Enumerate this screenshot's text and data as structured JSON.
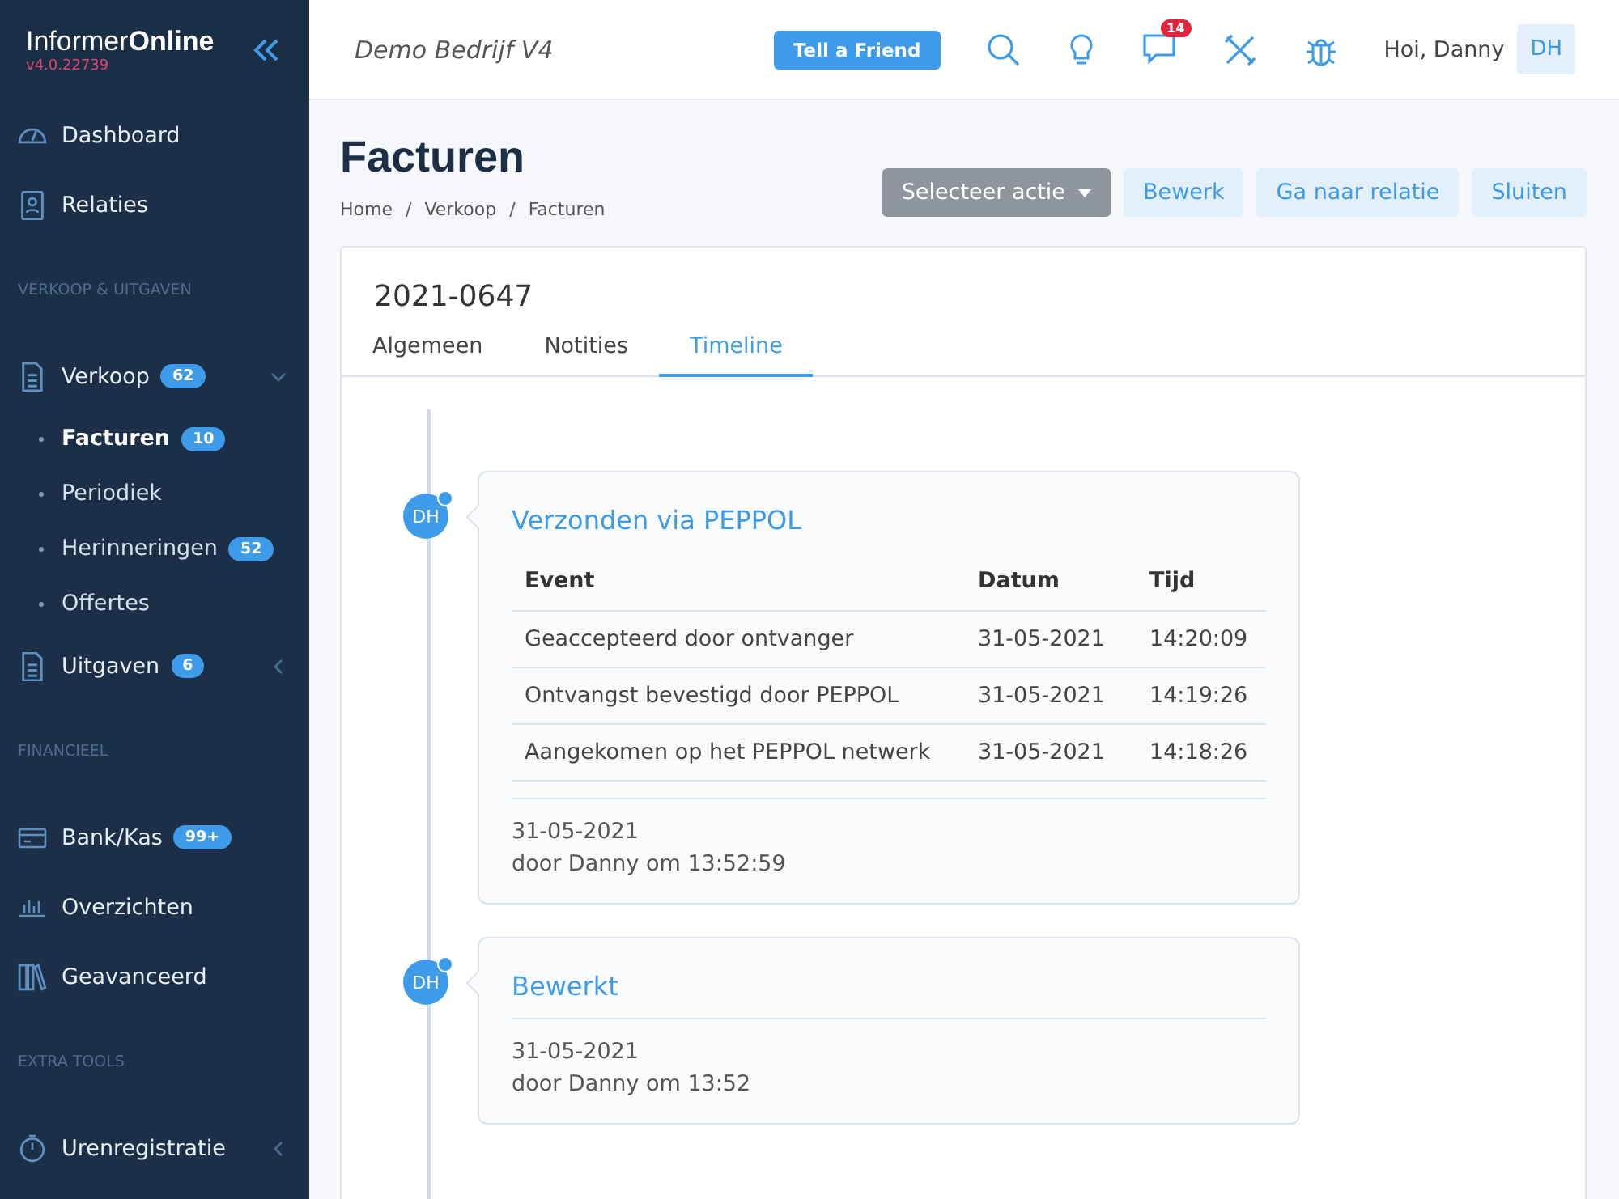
{
  "sidebar": {
    "logo_main": "Informer",
    "logo_bold": "Online",
    "version": "v4.0.22739",
    "items": [
      {
        "kind": "item",
        "label": "Dashboard"
      },
      {
        "kind": "item",
        "label": "Relaties"
      },
      {
        "kind": "header",
        "label": "VERKOOP & UITGAVEN"
      },
      {
        "kind": "item",
        "label": "Verkoop",
        "badge": "62",
        "expanded": true,
        "children": [
          {
            "label": "Facturen",
            "badge": "10",
            "selected": true
          },
          {
            "label": "Periodiek",
            "selected": false
          },
          {
            "label": "Herinneringen",
            "badge": "52",
            "selected": false
          },
          {
            "label": "Offertes",
            "selected": false
          }
        ]
      },
      {
        "kind": "item",
        "label": "Uitgaven",
        "badge": "6",
        "expanded": false
      },
      {
        "kind": "header",
        "label": "FINANCIEEL"
      },
      {
        "kind": "item",
        "label": "Bank/Kas",
        "badge": "99+"
      },
      {
        "kind": "item",
        "label": "Overzichten"
      },
      {
        "kind": "item",
        "label": "Geavanceerd"
      },
      {
        "kind": "header",
        "label": "EXTRA TOOLS"
      },
      {
        "kind": "item",
        "label": "Urenregistratie",
        "expanded": false
      }
    ]
  },
  "topbar": {
    "company": "Demo Bedrijf V4",
    "tell_button": "Tell a Friend",
    "messages_badge": "14",
    "greeting": "Hoi, Danny",
    "avatar": "DH"
  },
  "page": {
    "title": "Facturen",
    "breadcrumb": [
      "Home",
      "Verkoop",
      "Facturen"
    ],
    "breadcrumb_separators": [
      "/",
      "/"
    ],
    "actions": [
      {
        "kind": "dropdown",
        "label": "Selecteer actie"
      },
      {
        "kind": "light",
        "label": "Bewerk"
      },
      {
        "kind": "light",
        "label": "Ga naar relatie"
      },
      {
        "kind": "light",
        "label": "Sluiten"
      }
    ]
  },
  "card": {
    "number": "2021-0647",
    "tabs": [
      {
        "label": "Algemeen",
        "selected": false
      },
      {
        "label": "Notities",
        "selected": false
      },
      {
        "label": "Timeline",
        "selected": true
      }
    ],
    "timeline": [
      {
        "avatar": "DH",
        "title": "Verzonden via PEPPOL",
        "table": {
          "columns": [
            "Event",
            "Datum",
            "Tijd"
          ],
          "rows": [
            [
              "Geaccepteerd door ontvanger",
              "31-05-2021",
              "14:20:09"
            ],
            [
              "Ontvangst bevestigd door PEPPOL",
              "31-05-2021",
              "14:19:26"
            ],
            [
              "Aangekomen op het PEPPOL netwerk",
              "31-05-2021",
              "14:18:26"
            ]
          ]
        },
        "date": "31-05-2021",
        "author": "door Danny om 13:52:59"
      },
      {
        "avatar": "DH",
        "title": "Bewerkt",
        "date": "31-05-2021",
        "author": "door Danny om 13:52"
      }
    ]
  }
}
